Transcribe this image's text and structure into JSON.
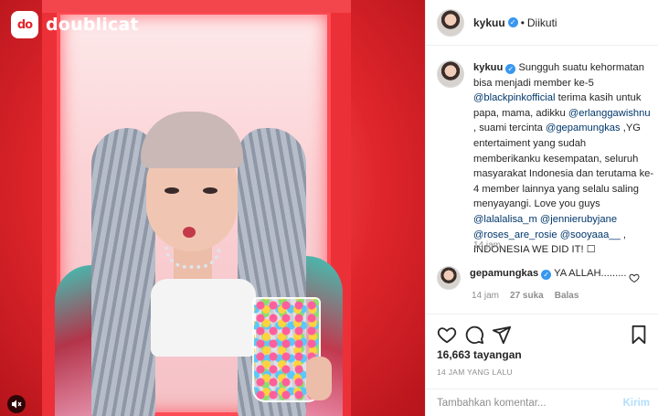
{
  "media": {
    "watermark": {
      "logo_mark": "do",
      "brand": "doublicat"
    },
    "sound_icon": "speaker-muted-icon"
  },
  "header": {
    "username": "kykuu",
    "separator": "•",
    "follow_status": "Diikuti"
  },
  "caption": {
    "username": "kykuu",
    "segments": [
      "Sungguh suatu kehormatan bisa menjadi member ke-5 ",
      "@blackpinkofficial",
      " terima kasih untuk papa, mama, adikku ",
      "@erlanggawishnu",
      " , suami tercinta ",
      "@gepamungkas",
      " ,YG entertaiment yang sudah memberikanku kesempatan, seluruh masyarakat Indonesia dan terutama ke-4 member lainnya yang selalu saling menyayangi. Love you guys ",
      "@lalalalisa_m",
      " ",
      "@jennierubyjane",
      " ",
      "@roses_are_rosie",
      " ",
      "@sooyaaa__",
      " , INDONESIA WE DID IT! ",
      "☐"
    ],
    "time": "14 jam"
  },
  "comment": {
    "username": "gepamungkas",
    "text": "YA ALLAH.........",
    "time": "14 jam",
    "likes": "27 suka",
    "reply": "Balas"
  },
  "actions": {
    "like_icon": "heart-icon",
    "comment_icon": "comment-icon",
    "share_icon": "share-icon",
    "save_icon": "bookmark-icon"
  },
  "stats": {
    "views": "16,663 tayangan",
    "posted": "14 JAM YANG LALU"
  },
  "comment_box": {
    "placeholder": "Tambahkan komentar...",
    "post_label": "Kirim"
  },
  "colors": {
    "accent": "#3897f0",
    "mention": "#00376b",
    "muted": "#8e8e8e",
    "brand_red": "#e0262c"
  }
}
